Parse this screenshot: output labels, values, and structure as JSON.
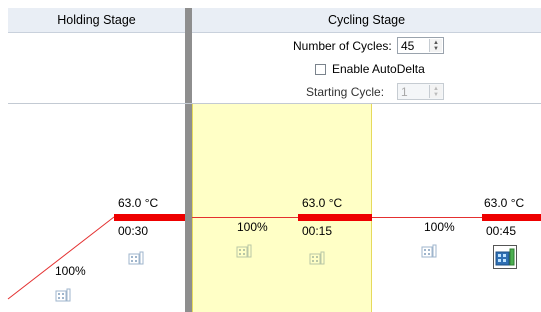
{
  "stages": {
    "holding": {
      "title": "Holding Stage"
    },
    "cycling": {
      "title": "Cycling Stage"
    }
  },
  "cycling_settings": {
    "num_cycles_label": "Number of Cycles:",
    "num_cycles_value": "45",
    "auto_delta_label": "Enable AutoDelta",
    "auto_delta_checked": false,
    "starting_cycle_label": "Starting Cycle:",
    "starting_cycle_value": "1"
  },
  "steps": [
    {
      "temp": "63.0 °C",
      "time": "00:30",
      "ramp": "100%"
    },
    {
      "temp": "63.0 °C",
      "time": "00:15",
      "ramp": "100%"
    },
    {
      "temp": "63.0 °C",
      "time": "00:45",
      "ramp": "100%"
    }
  ],
  "colors": {
    "bar": "#ee0000",
    "highlight": "#ffffc6",
    "divider": "#8e8e8e"
  }
}
